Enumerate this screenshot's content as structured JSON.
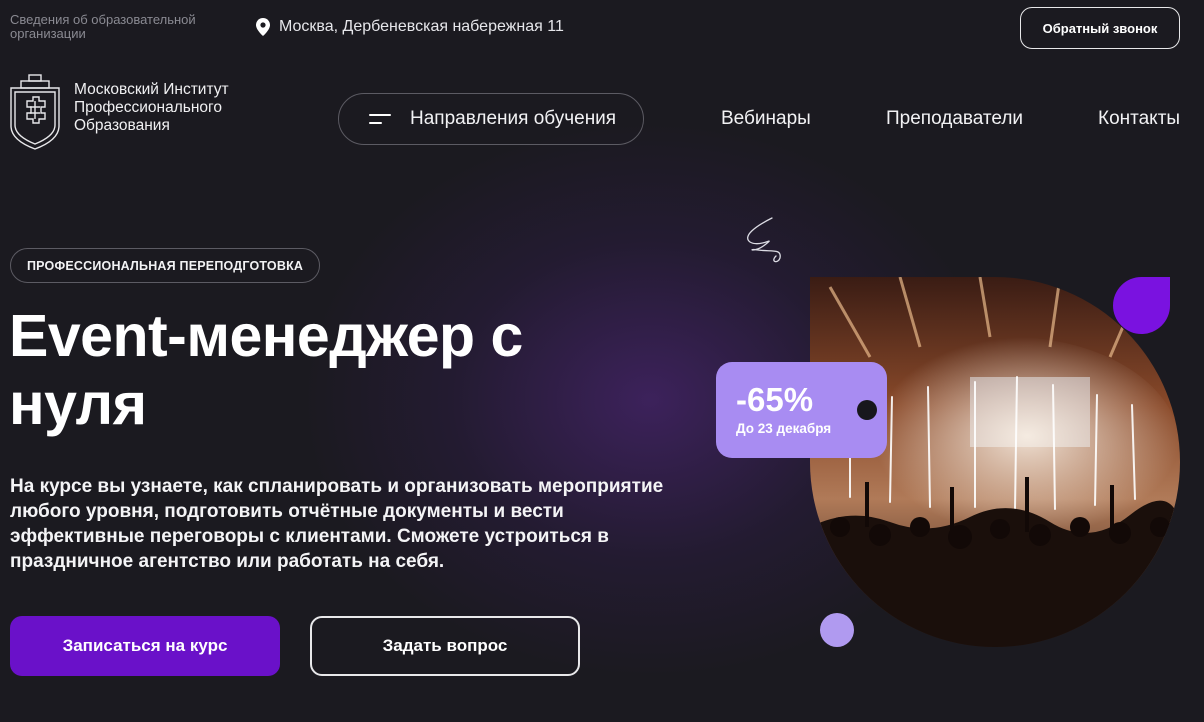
{
  "topbar": {
    "org_info": "Сведения об образовательной организации",
    "address": "Москва, Дербеневская набережная 11",
    "callback_label": "Обратный звонок"
  },
  "logo": {
    "line1": "Московский Институт",
    "line2": "Профессионального",
    "line3": "Образования"
  },
  "nav": {
    "directions_label": "Направления обучения",
    "links": [
      "Вебинары",
      "Преподаватели",
      "Контакты"
    ]
  },
  "hero": {
    "badge": "ПРОФЕССИОНАЛЬНАЯ ПЕРЕПОДГОТОВКА",
    "title_line1": "Event-менеджер с",
    "title_line2": "нуля",
    "description": "На курсе вы узнаете, как спланировать и организовать мероприятие любого уровня, подготовить отчётные документы и вести эффективные переговоры с клиентами. Сможете устроиться в праздничное агентство или работать на себя.",
    "enroll_label": "Записаться на курс",
    "question_label": "Задать вопрос"
  },
  "promo": {
    "discount": "-65%",
    "until": "До 23 декабря"
  },
  "colors": {
    "background": "#1b1a20",
    "accent": "#6a11c9",
    "tag": "#a88cf2",
    "drop": "#7a12e0",
    "dot": "#b09af0"
  },
  "icons": [
    "location-pin-icon",
    "menu-lines-icon",
    "shield-logo-icon",
    "scribble-decoration"
  ]
}
